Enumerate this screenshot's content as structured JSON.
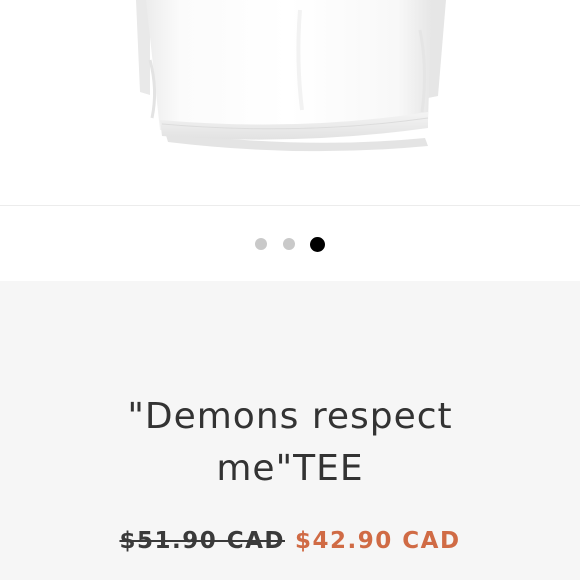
{
  "gallery": {
    "image_alt": "White t-shirt",
    "dots": [
      {
        "active": false
      },
      {
        "active": false
      },
      {
        "active": true
      }
    ]
  },
  "product": {
    "title_line1": "\"Demons respect",
    "title_line2": "me\"TEE",
    "compare_price": "$51.90 CAD",
    "sale_price": "$42.90 CAD"
  },
  "colors": {
    "sale_price": "#d06b45",
    "active_dot": "#000000",
    "inactive_dot": "#c9c9c9",
    "info_background": "#f6f6f6"
  }
}
